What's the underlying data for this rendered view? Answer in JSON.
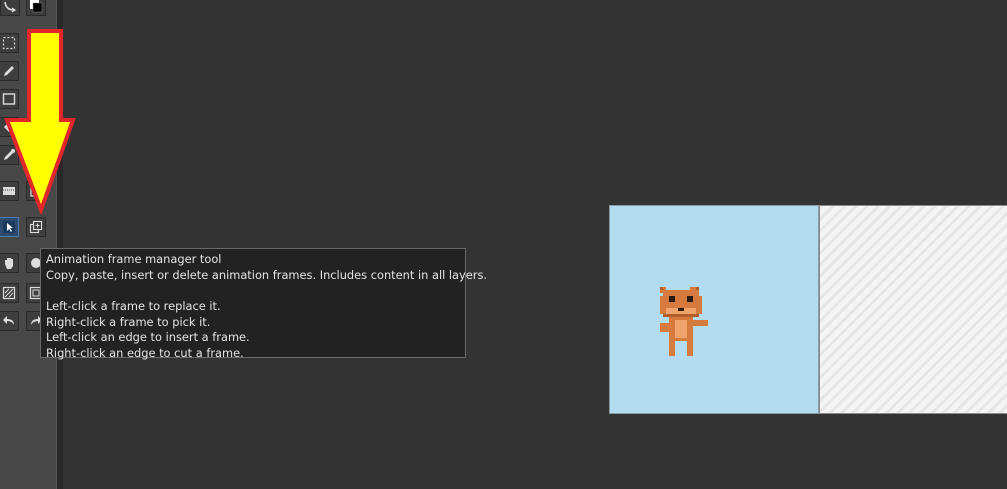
{
  "tooltip": {
    "title": "Animation frame manager tool",
    "description": "Copy, paste, insert or delete animation frames. Includes content in all layers.",
    "instructions": [
      "Left-click a frame to replace it.",
      "Right-click a frame to pick it.",
      "Left-click an edge to insert a frame.",
      "Right-click an edge to cut a frame."
    ]
  },
  "toolbox": {
    "tools": [
      {
        "name": "curve-tool",
        "icon": "curve-icon"
      },
      {
        "name": "color-swap-tool",
        "icon": "color-swap-icon"
      },
      {
        "name": "selection-tool",
        "icon": "marquee-icon"
      },
      {
        "name": "pencil-tool",
        "icon": "pencil-icon"
      },
      {
        "name": "rectangle-tool",
        "icon": "rectangle-icon"
      },
      {
        "name": "fill-tool",
        "icon": "bucket-icon"
      },
      {
        "name": "eyedropper-tool",
        "icon": "eyedropper-icon"
      },
      {
        "name": "gradient-tool",
        "icon": "gradient-icon"
      },
      {
        "name": "move-selection-tool",
        "icon": "cursor-icon"
      },
      {
        "name": "animation-frame-manager-tool",
        "icon": "frame-manager-icon"
      },
      {
        "name": "pan-tool",
        "icon": "hand-icon"
      },
      {
        "name": "ellipse-tool",
        "icon": "circle-icon"
      },
      {
        "name": "pattern-tool",
        "icon": "pattern-icon"
      },
      {
        "name": "frame-tool",
        "icon": "frame-icon"
      },
      {
        "name": "undo-tool",
        "icon": "undo-icon"
      },
      {
        "name": "redo-tool",
        "icon": "redo-icon"
      }
    ]
  },
  "annotation": {
    "arrow_fill": "#ffff00",
    "arrow_stroke": "#e3262a"
  },
  "canvas": {
    "frame_background": "#b3dcf0",
    "sprite_color": "#e08a4a"
  }
}
